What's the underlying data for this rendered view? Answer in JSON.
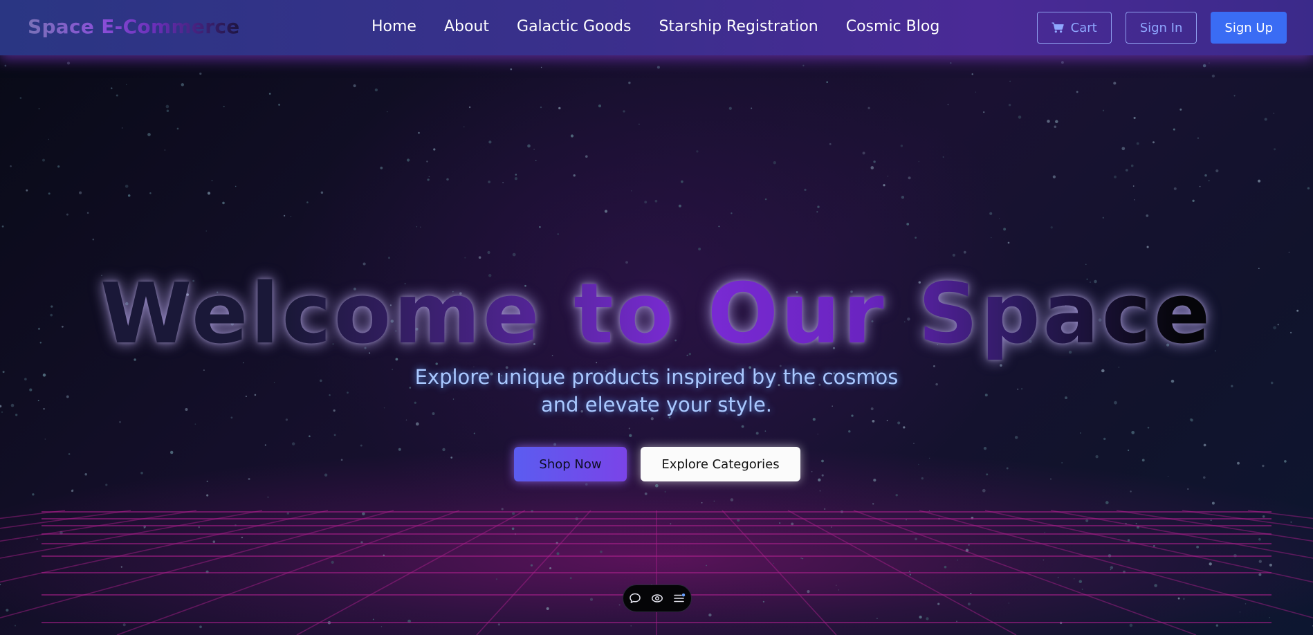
{
  "header": {
    "brand": "Space E-Commerce",
    "nav": [
      {
        "label": "Home"
      },
      {
        "label": "About"
      },
      {
        "label": "Galactic Goods"
      },
      {
        "label": "Starship Registration"
      },
      {
        "label": "Cosmic Blog"
      }
    ],
    "cart_label": "Cart",
    "signin_label": "Sign In",
    "signup_label": "Sign Up",
    "cart_icon": "shopping-cart-icon"
  },
  "hero": {
    "title": "Welcome to Our Space",
    "subtitle_line1": "Explore unique products inspired by the cosmos",
    "subtitle_line2": "and elevate your style.",
    "shop_label": "Shop Now",
    "explore_label": "Explore Categories"
  },
  "toolbar": {
    "tools": [
      {
        "icon": "comment-icon"
      },
      {
        "icon": "eye-icon"
      },
      {
        "icon": "list-icon"
      }
    ]
  },
  "colors": {
    "accent": "#3a6cf4",
    "nav_start": "#2a3683",
    "nav_end": "#4a2a96",
    "subtitle": "#a9c8ff",
    "shop_button": "#5b5cf0"
  }
}
